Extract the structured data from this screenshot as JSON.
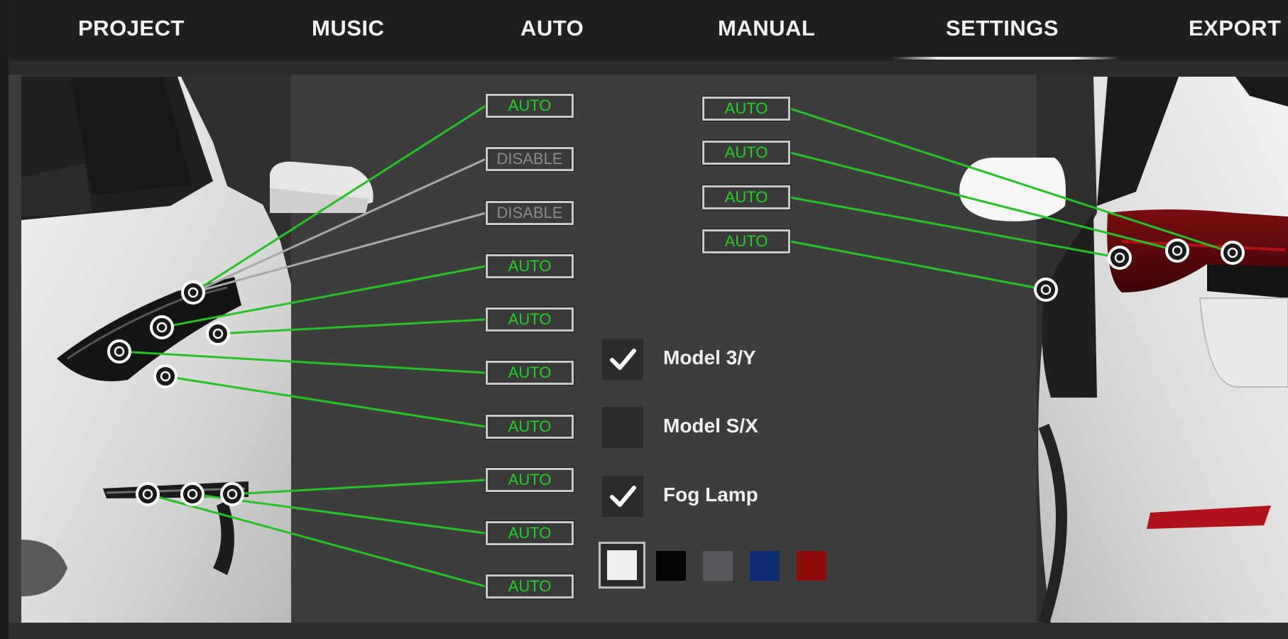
{
  "nav": {
    "tabs": [
      {
        "label": "PROJECT"
      },
      {
        "label": "MUSIC"
      },
      {
        "label": "AUTO"
      },
      {
        "label": "MANUAL"
      },
      {
        "label": "SETTINGS",
        "active": true
      },
      {
        "label": "EXPORT"
      }
    ]
  },
  "front_lights": [
    {
      "label": "AUTO",
      "state": "auto"
    },
    {
      "label": "DISABLE",
      "state": "disable"
    },
    {
      "label": "DISABLE",
      "state": "disable"
    },
    {
      "label": "AUTO",
      "state": "auto"
    },
    {
      "label": "AUTO",
      "state": "auto"
    },
    {
      "label": "AUTO",
      "state": "auto"
    },
    {
      "label": "AUTO",
      "state": "auto"
    },
    {
      "label": "AUTO",
      "state": "auto"
    },
    {
      "label": "AUTO",
      "state": "auto"
    },
    {
      "label": "AUTO",
      "state": "auto"
    }
  ],
  "rear_lights": [
    {
      "label": "AUTO",
      "state": "auto"
    },
    {
      "label": "AUTO",
      "state": "auto"
    },
    {
      "label": "AUTO",
      "state": "auto"
    },
    {
      "label": "AUTO",
      "state": "auto"
    }
  ],
  "options": [
    {
      "label": "Model 3/Y",
      "checked": true
    },
    {
      "label": "Model S/X",
      "checked": false
    },
    {
      "label": "Fog Lamp",
      "checked": true
    }
  ],
  "car_colors": [
    {
      "name": "white",
      "hex": "#eeeeee",
      "selected": true
    },
    {
      "name": "black",
      "hex": "#050505"
    },
    {
      "name": "gray",
      "hex": "#55575c"
    },
    {
      "name": "blue",
      "hex": "#0d2a73"
    },
    {
      "name": "red",
      "hex": "#8e0b0b"
    }
  ],
  "colors": {
    "auto_text": "#1fd01f",
    "disable_text": "#8a8a8a",
    "line_auto": "#22c322",
    "line_disable": "#a8a8a8"
  }
}
